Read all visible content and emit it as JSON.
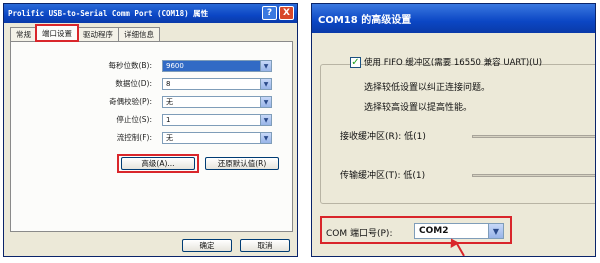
{
  "left_dialog": {
    "title": "Prolific USB-to-Serial Comm Port (COM18) 属性",
    "help_button": "?",
    "close_button": "X",
    "tabs": [
      {
        "label": "常规"
      },
      {
        "label": "端口设置"
      },
      {
        "label": "驱动程序"
      },
      {
        "label": "详细信息"
      }
    ],
    "fields": [
      {
        "label": "每秒位数(B):",
        "value": "9600"
      },
      {
        "label": "数据位(D):",
        "value": "8"
      },
      {
        "label": "奇偶校验(P):",
        "value": "无"
      },
      {
        "label": "停止位(S):",
        "value": "1"
      },
      {
        "label": "流控制(F):",
        "value": "无"
      }
    ],
    "advanced_button": "高级(A)...",
    "restore_button": "还原默认值(R)",
    "ok_button": "确定",
    "cancel_button": "取消"
  },
  "right_dialog": {
    "title": "COM18 的高级设置",
    "fifo_checkbox": "使用 FIFO 缓冲区(需要 16550 兼容 UART)(U)",
    "fifo_checked": true,
    "hint_low": "选择较低设置以纠正连接问题。",
    "hint_high": "选择较高设置以提高性能。",
    "receive_buffer": "接收缓冲区(R): 低(1)",
    "transmit_buffer": "传输缓冲区(T): 低(1)",
    "com_port_label": "COM 端口号(P):",
    "com_port_value": "COM2"
  },
  "colors": {
    "highlight": "#d9262b",
    "titlebar": "#0b46c4",
    "dialog_bg": "#ece9d8"
  }
}
